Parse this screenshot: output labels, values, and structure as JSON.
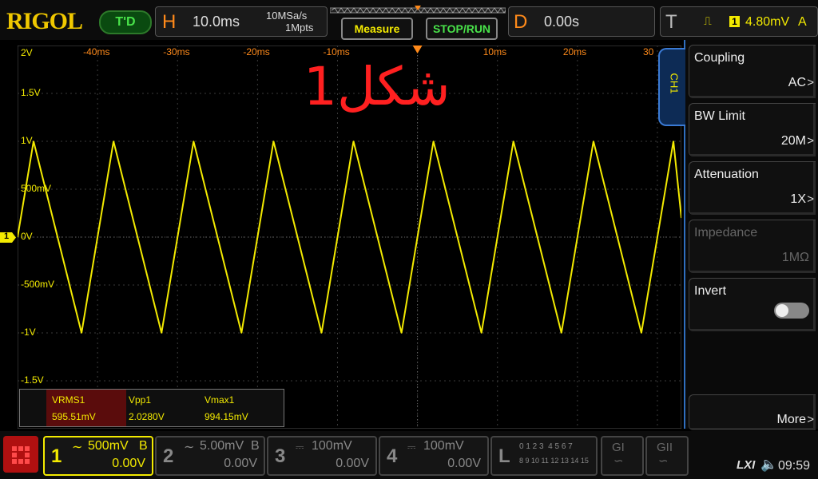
{
  "brand": "RIGOL",
  "trigger_mode_button": "T'D",
  "horizontal": {
    "letter": "H",
    "timebase": "10.0ms",
    "sample_rate": "10MSa/s",
    "memory_depth": "1Mpts"
  },
  "buttons": {
    "measure": "Measure",
    "stop_run": "STOP/RUN"
  },
  "delay": {
    "letter": "D",
    "value": "0.00s"
  },
  "trigger": {
    "letter": "T",
    "channel": "1",
    "level": "4.80mV",
    "mode": "A"
  },
  "overlay_text": "شكل1",
  "y_axis_labels": [
    "2V",
    "1.5V",
    "1V",
    "500mV",
    "0V",
    "-500mV",
    "-1V",
    "-1.5V"
  ],
  "x_axis_labels": [
    "-40ms",
    "-30ms",
    "-20ms",
    "-10ms",
    "10ms",
    "20ms",
    "30"
  ],
  "ground_marker": "1",
  "channel_tab": "CH1",
  "menu": [
    {
      "title": "Coupling",
      "value": "AC"
    },
    {
      "title": "BW Limit",
      "value": "20M"
    },
    {
      "title": "Attenuation",
      "value": "1X"
    },
    {
      "title": "Impedance",
      "value": "1MΩ"
    },
    {
      "title": "Invert",
      "value": ""
    },
    {
      "title": "",
      "value": "More"
    }
  ],
  "measurements": [
    {
      "name": "VRMS1",
      "value": "595.51mV"
    },
    {
      "name": "Vpp1",
      "value": "2.0280V"
    },
    {
      "name": "Vmax1",
      "value": "994.15mV"
    }
  ],
  "channels": [
    {
      "num": "1",
      "scale": "500mV",
      "bw": "B",
      "offset": "0.00V"
    },
    {
      "num": "2",
      "scale": "5.00mV",
      "bw": "B",
      "offset": "0.00V"
    },
    {
      "num": "3",
      "scale": "100mV",
      "bw": "",
      "offset": "0.00V"
    },
    {
      "num": "4",
      "scale": "100mV",
      "bw": "",
      "offset": "0.00V"
    }
  ],
  "logic": {
    "letter": "L",
    "row1": "0 1 2 3  4 5 6 7",
    "row2": "8 9 10 11 12 13 14 15"
  },
  "status": {
    "lxi": "LXI",
    "time": "09:59"
  },
  "colors": {
    "ch1": "#f3ea00",
    "accent": "#ff8a1a",
    "menu_border": "#2f6fbf",
    "overlay": "#ff2020"
  },
  "chart_data": {
    "type": "line",
    "title": "",
    "xlabel": "",
    "ylabel": "",
    "xlim": [
      -50,
      33
    ],
    "ylim": [
      -2,
      2
    ],
    "series": [
      {
        "values_description_none": null,
        "x": [
          -50,
          -48,
          -38,
          -28,
          -18,
          -8,
          2,
          12,
          22,
          32
        ],
        "y": [
          0.0,
          1.0,
          1.0,
          1.0,
          1.0,
          1.0,
          1.0,
          1.0,
          1.0,
          1.0
        ]
      }
    ],
    "troughs": {
      "x": [
        -42,
        -32,
        -22,
        -12,
        -2,
        8,
        18,
        28
      ],
      "y": [
        -1.0,
        -1.0,
        -1.0,
        -1.0,
        -1.0,
        -1.0,
        -1.0,
        -1.0
      ]
    },
    "grid": true
  }
}
